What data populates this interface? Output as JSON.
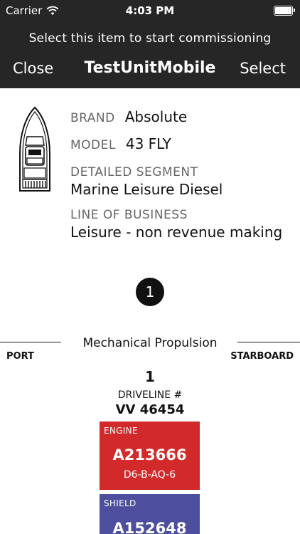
{
  "status_bar": {
    "carrier": "Carrier",
    "time": "4:03 PM",
    "icons": [
      "wifi-icon",
      "battery-icon"
    ]
  },
  "header": {
    "subtitle": "Select this item to start commissioning",
    "close_label": "Close",
    "title": "TestUnitMobile",
    "select_label": "Select"
  },
  "unit": {
    "icon": "boat-icon",
    "brand_label": "BRAND",
    "brand_value": "Absolute",
    "model_label": "MODEL",
    "model_value": "43 FLY",
    "segment_label": "DETAILED SEGMENT",
    "segment_value": "Marine Leisure Diesel",
    "business_label": "LINE OF BUSINESS",
    "business_value": "Leisure - non revenue making"
  },
  "badge": "1",
  "propulsion": {
    "title": "Mechanical Propulsion",
    "port_label": "PORT",
    "starboard_label": "STARBOARD",
    "driveline_number": "1",
    "driveline_label": "DRIVELINE #",
    "driveline_value": "VV 46454",
    "engine": {
      "label": "ENGINE",
      "code": "A213666",
      "sub": "D6-B-AQ-6",
      "color": "#d22a2a"
    },
    "shield": {
      "label": "SHIELD",
      "code": "A152648",
      "color": "#4d4f9e"
    }
  }
}
